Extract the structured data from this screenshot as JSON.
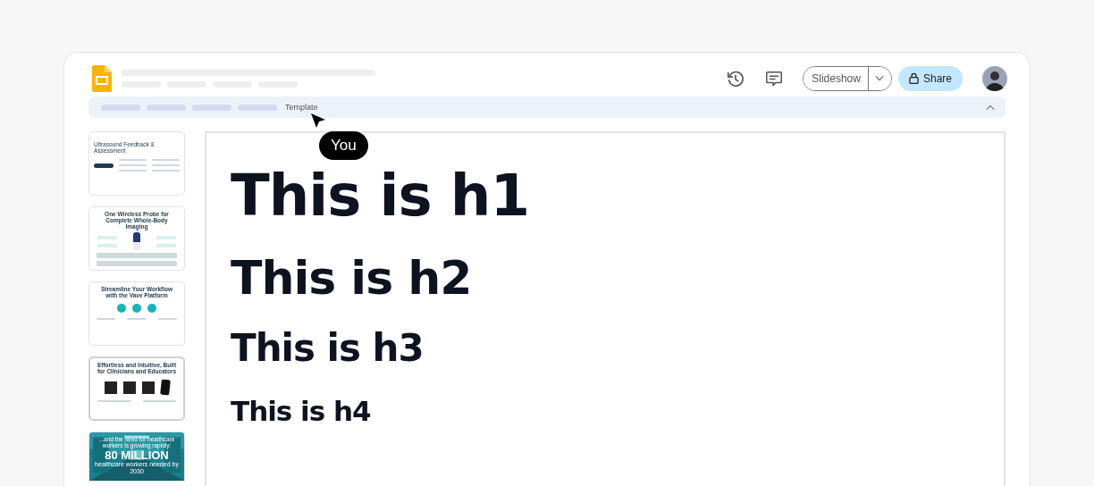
{
  "header": {
    "slideshow_button": {
      "label": "Slideshow"
    },
    "share_button": {
      "label": "Share"
    }
  },
  "toolbar": {
    "breadcrumb": "Template",
    "collapsed": false
  },
  "cursor": {
    "label": "You"
  },
  "slides": [
    {
      "kind": "table",
      "title": "Ultrasound Feedback & Assessment",
      "selected": false
    },
    {
      "kind": "product",
      "title": "One Wireless Probe for Complete Whole-Body Imaging",
      "selected": false
    },
    {
      "kind": "features",
      "title": "Streamline Your Workflow with the Vave Platform",
      "selected": false
    },
    {
      "kind": "screens",
      "title": "Effortless and Intuitive, Built for Clinicians and Educators",
      "selected": true
    },
    {
      "kind": "stat",
      "title": "...and the need for healthcare workers is growing rapidly:",
      "stat": "80 MILLION",
      "caption": "healthcare workers needed by 2030",
      "selected": false
    }
  ],
  "canvas": {
    "headings": [
      {
        "kind": "h1",
        "text": "This is h1"
      },
      {
        "kind": "h2",
        "text": "This is h2"
      },
      {
        "kind": "h3",
        "text": "This is h3"
      },
      {
        "kind": "h4",
        "text": "This is h4"
      }
    ]
  }
}
